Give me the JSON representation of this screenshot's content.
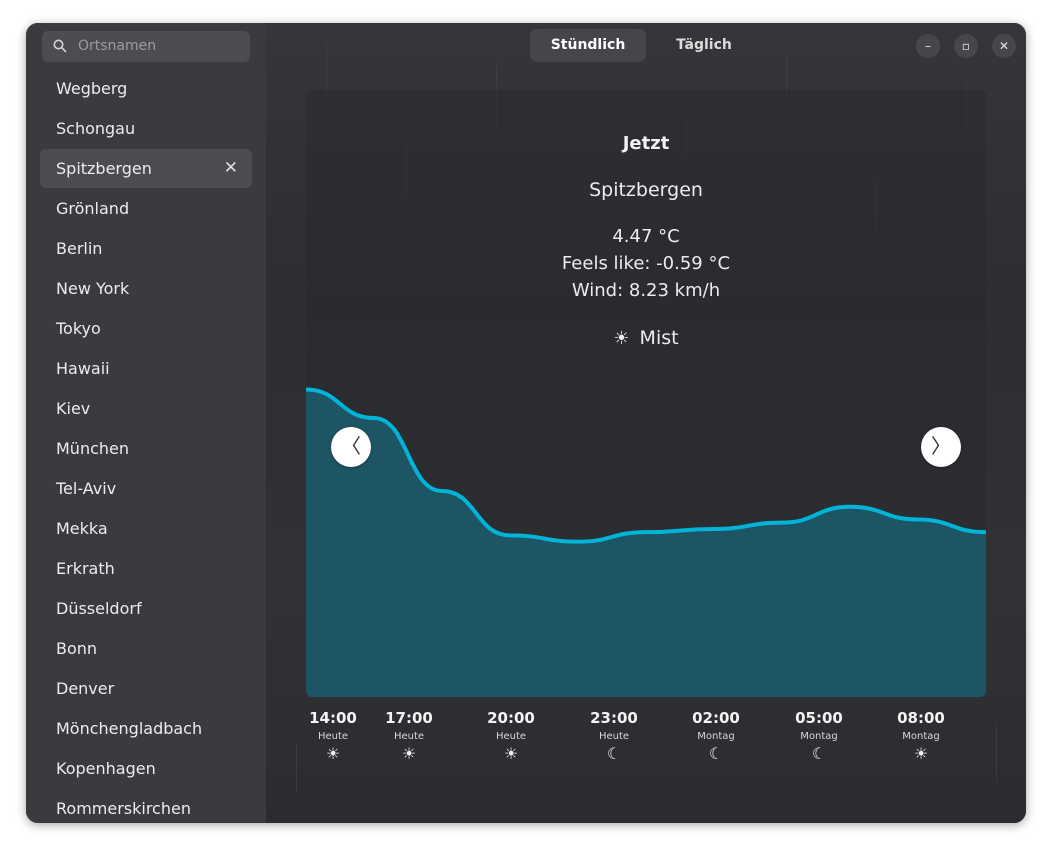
{
  "sidebar": {
    "search_placeholder": "Ortsnamen",
    "cities": [
      {
        "label": "Wegberg"
      },
      {
        "label": "Schongau"
      },
      {
        "label": "Spitzbergen",
        "selected": true
      },
      {
        "label": "Grönland"
      },
      {
        "label": "Berlin"
      },
      {
        "label": "New York"
      },
      {
        "label": "Tokyo"
      },
      {
        "label": "Hawaii"
      },
      {
        "label": "Kiev"
      },
      {
        "label": "München"
      },
      {
        "label": "Tel-Aviv"
      },
      {
        "label": "Mekka"
      },
      {
        "label": "Erkrath"
      },
      {
        "label": "Düsseldorf"
      },
      {
        "label": "Bonn"
      },
      {
        "label": "Denver"
      },
      {
        "label": "Mönchengladbach"
      },
      {
        "label": "Kopenhagen"
      },
      {
        "label": "Rommerskirchen"
      }
    ],
    "remove_icon": "✕"
  },
  "header": {
    "tabs": [
      {
        "label": "Stündlich",
        "active": true
      },
      {
        "label": "Täglich",
        "active": false
      }
    ],
    "window_buttons": {
      "minimize": "–",
      "maximize": "▫",
      "close": "✕"
    }
  },
  "current": {
    "title": "Jetzt",
    "location": "Spitzbergen",
    "temperature": "4.47 °C",
    "feels_like": "Feels like: -0.59 °C",
    "wind": "Wind: 8.23 km/h",
    "condition": "Mist",
    "condition_icon": "sun-icon"
  },
  "forecast_nav": {
    "prev": "〈",
    "next": "〉"
  },
  "chart_data": {
    "type": "area",
    "color": "#00b4d8",
    "fill": "#1d5a6a",
    "relative_levels": [
      0.97,
      0.88,
      0.65,
      0.51,
      0.49,
      0.52,
      0.53,
      0.55,
      0.6,
      0.56,
      0.52
    ]
  },
  "hourly": [
    {
      "time": "14:00",
      "day": "Heute",
      "icon": "☀",
      "icon_name": "cloud-sun-icon"
    },
    {
      "time": "17:00",
      "day": "Heute",
      "icon": "☀",
      "icon_name": "cloud-sun-icon"
    },
    {
      "time": "20:00",
      "day": "Heute",
      "icon": "☀",
      "icon_name": "cloud-sun-icon"
    },
    {
      "time": "23:00",
      "day": "Heute",
      "icon": "☾",
      "icon_name": "cloud-moon-icon"
    },
    {
      "time": "02:00",
      "day": "Montag",
      "icon": "☾",
      "icon_name": "cloud-moon-icon"
    },
    {
      "time": "05:00",
      "day": "Montag",
      "icon": "☾",
      "icon_name": "cloud-moon-icon"
    },
    {
      "time": "08:00",
      "day": "Montag",
      "icon": "☀",
      "icon_name": "cloud-sun-icon"
    }
  ]
}
